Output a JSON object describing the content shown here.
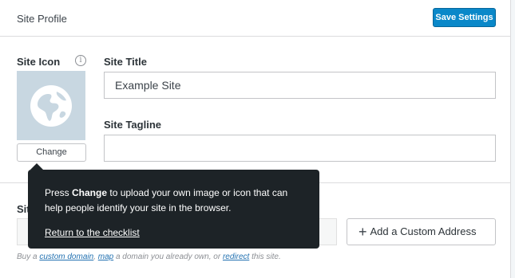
{
  "header": {
    "title": "Site Profile",
    "save_label": "Save Settings"
  },
  "site_icon": {
    "label": "Site Icon",
    "info_glyph": "i",
    "change_label": "Change",
    "icon_name": "globe-icon"
  },
  "site_title": {
    "label": "Site Title",
    "value": "Example Site"
  },
  "site_tagline": {
    "label": "Site Tagline",
    "value": ""
  },
  "site_address": {
    "label_visible": "Sit",
    "add_button_label": "Add a Custom Address",
    "help_prefix": "Buy a ",
    "help_link_1": "custom domain",
    "help_sep_1": ", ",
    "help_link_2": "map",
    "help_mid": " a domain you already own, or ",
    "help_link_3": "redirect",
    "help_suffix": " this site."
  },
  "tooltip": {
    "text_prefix": "Press ",
    "text_bold": "Change",
    "text_suffix": " to upload your own image or icon that can help people identify your site in the browser.",
    "link_label": "Return to the checklist"
  },
  "colors": {
    "primary": "#0a88c9",
    "tooltip_bg": "#1d2327",
    "icon_placeholder": "#c8d7e1",
    "link": "#2271b1"
  }
}
